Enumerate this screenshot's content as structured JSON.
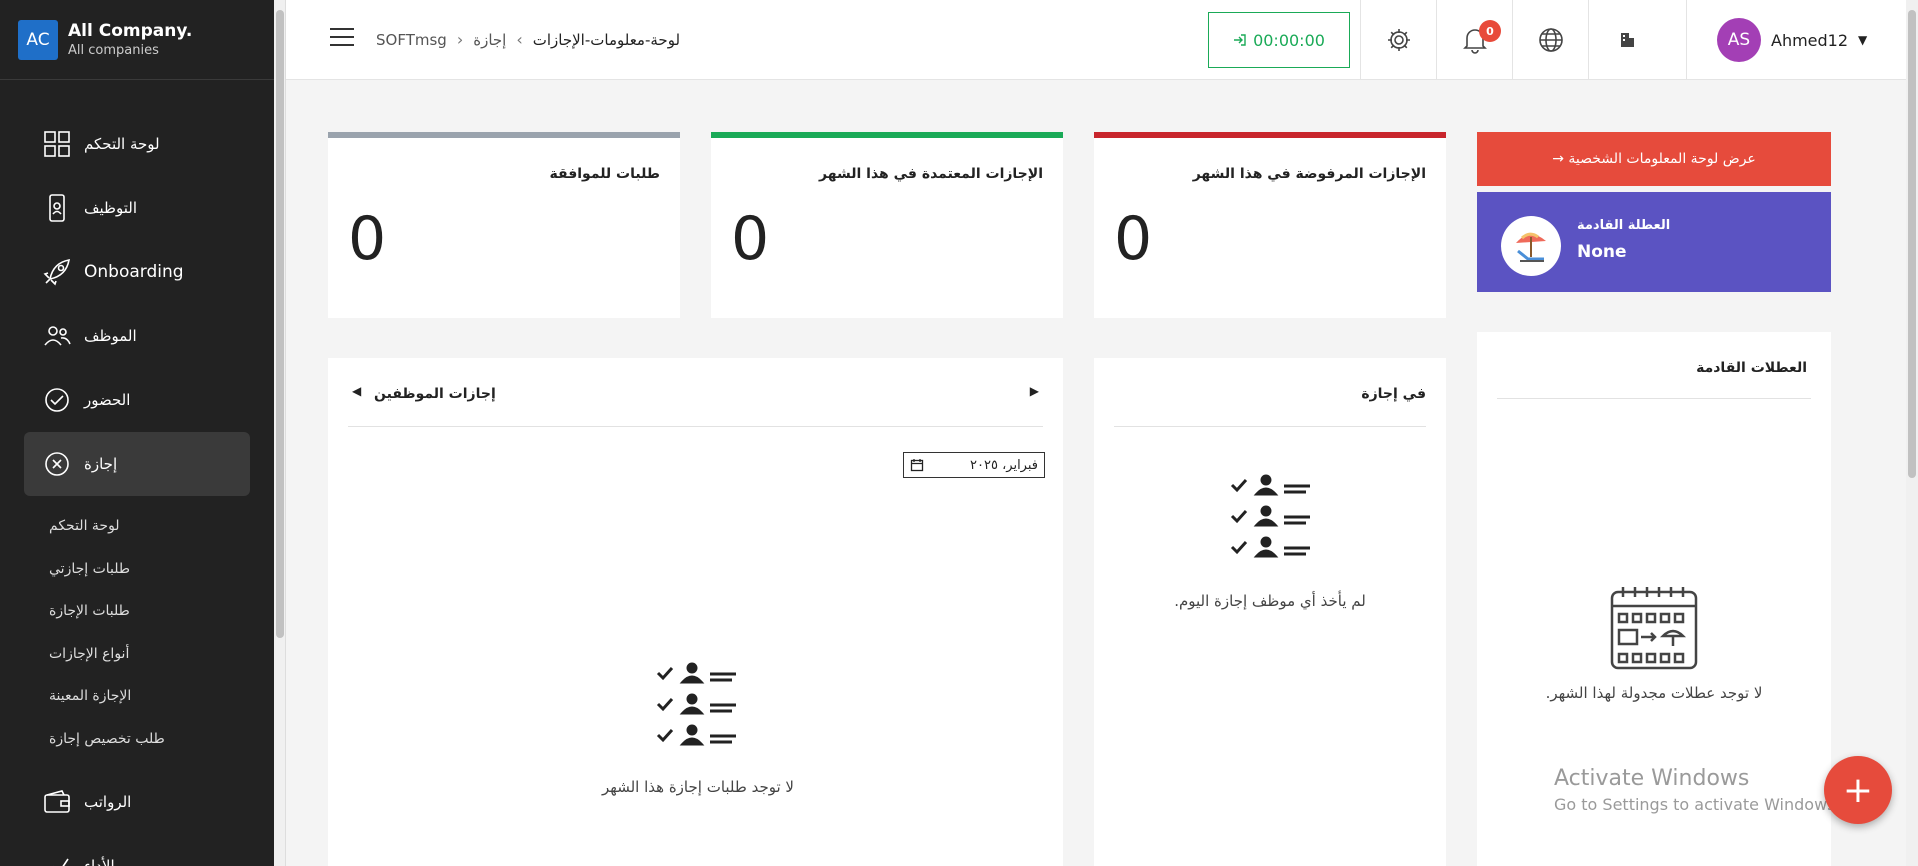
{
  "company": {
    "initials": "AC",
    "name": "All Company.",
    "sub": "All companies"
  },
  "sidebar": {
    "items": [
      {
        "label": "لوحة التحكم",
        "icon": "dashboard-icon"
      },
      {
        "label": "التوظيف",
        "icon": "recruitment-icon"
      },
      {
        "label": "Onboarding",
        "icon": "rocket-icon"
      },
      {
        "label": "الموظف",
        "icon": "employees-icon"
      },
      {
        "label": "الحضور",
        "icon": "attendance-icon"
      },
      {
        "label": "إجازة",
        "icon": "leave-icon"
      },
      {
        "label": "الرواتب",
        "icon": "wallet-icon"
      },
      {
        "label": "الأداء",
        "icon": "performance-icon"
      }
    ],
    "subitems": [
      "لوحة التحكم",
      "طلبات إجازتي",
      "طلبات الإجازة",
      "أنواع الإجازات",
      "الإجازة المعينة",
      "طلب تخصيص إجازة"
    ]
  },
  "header": {
    "breadcrumb": [
      "SOFTmsg",
      "إجازة",
      "لوحة-معلومات-الإجازات"
    ],
    "timer": "00:00:00",
    "notifications": "0",
    "user_initials": "AS",
    "user_name": "Ahmed12"
  },
  "stats": [
    {
      "title": "طلبات للموافقة",
      "value": "0",
      "color": "#9aa3ad"
    },
    {
      "title": "الإجازات المعتمدة في هذا الشهر",
      "value": "0",
      "color": "#1aaa57"
    },
    {
      "title": "الإجازات المرفوضة في هذا الشهر",
      "value": "0",
      "color": "#c8262c"
    }
  ],
  "profile_button": "عرض لوحة المعلومات الشخصية →",
  "next_holiday": {
    "label": "العطلة القادمة",
    "value": "None"
  },
  "employee_leaves": {
    "title": "إجازات الموظفين",
    "month": "فبراير، ٢٠٢٥",
    "empty": "لا توجد طلبات إجازة هذا الشهر"
  },
  "on_leave": {
    "title": "في إجازة",
    "empty": "لم يأخذ أي موظف إجازة اليوم."
  },
  "upcoming_holidays": {
    "title": "العطلات القادمة",
    "empty": "لا توجد عطلات مجدولة لهذا الشهر."
  },
  "watermark": {
    "line1": "Activate Windows",
    "line2": "Go to Settings to activate Windows."
  },
  "colors": {
    "sidebar": "#222222",
    "accent_red": "#e64b3c",
    "holiday_purple": "#5b53c2",
    "timer_green": "#1aaa57"
  }
}
